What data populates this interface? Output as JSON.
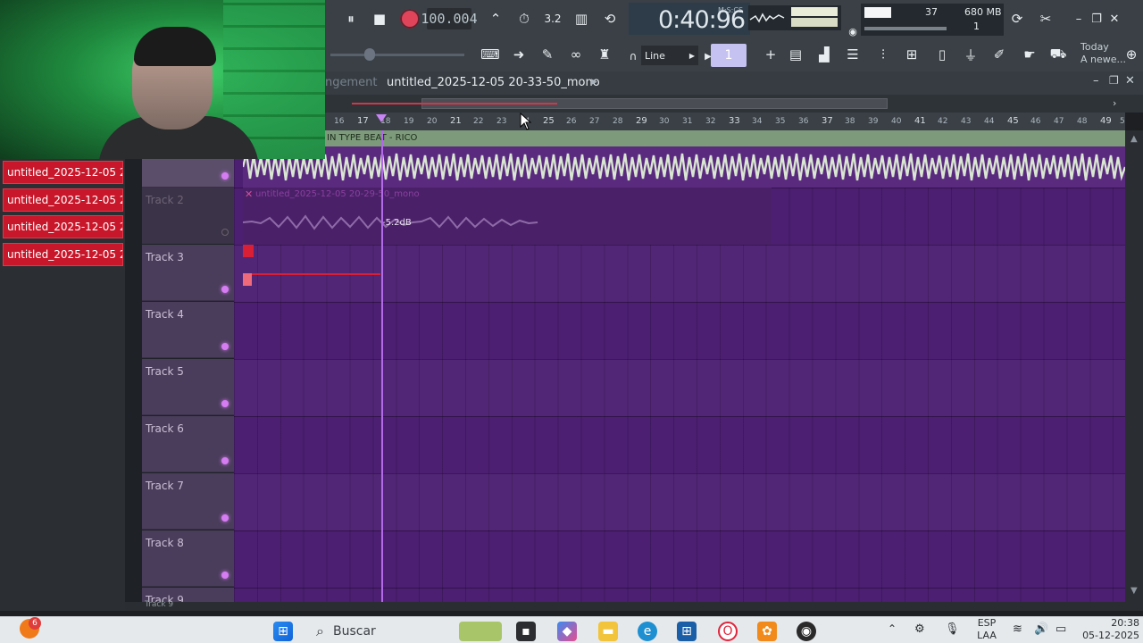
{
  "toolbar": {
    "tempo": "100.004",
    "time": "0:40:96",
    "time_label": "M:S:CS",
    "cpu_value": "37",
    "memory": "680 MB",
    "voices": "1",
    "snap": "Line",
    "pattern_number": "1",
    "hint_title": "Today",
    "hint_text": "A newe..."
  },
  "playlist": {
    "crumb": "ngement",
    "title": "untitled_2025-12-05 20-33-50_mono",
    "ruler_numbers": [
      "16",
      "17",
      "18",
      "19",
      "20",
      "21",
      "22",
      "23",
      "24",
      "25",
      "26",
      "27",
      "28",
      "29",
      "30",
      "31",
      "32",
      "33",
      "34",
      "35",
      "36",
      "37",
      "38",
      "39",
      "40",
      "41",
      "42",
      "43",
      "44",
      "45",
      "46",
      "47",
      "48",
      "49",
      "5"
    ],
    "track1_clip_label": "IN TYPE BEAT - RICO",
    "clip2_label": "untitled_2025-12-05 20-29-50_mono",
    "clip2_gain": "-5.2dB",
    "bottom_label": "Track 9"
  },
  "browser": {
    "items": [
      "untitled_2025-12-05 20...",
      "untitled_2025-12-05 20...",
      "untitled_2025-12-05 20...",
      "untitled_2025-12-05 20..."
    ]
  },
  "tracks": [
    {
      "name": "Track 2"
    },
    {
      "name": "Track 3"
    },
    {
      "name": "Track 4"
    },
    {
      "name": "Track 5"
    },
    {
      "name": "Track 6"
    },
    {
      "name": "Track 7"
    },
    {
      "name": "Track 8"
    },
    {
      "name": "Track 9"
    }
  ],
  "taskbar": {
    "search_placeholder": "Buscar",
    "badge_count": "6",
    "lang_line1": "ESP",
    "lang_line2": "LAA",
    "time": "20:38",
    "date": "05-12-2025"
  },
  "colors": {
    "grid_bg": "#4c1f72",
    "clip_red": "#c8172a",
    "track_header": "#4a3d5b",
    "playhead": "#b36ae8",
    "record": "#e0445a"
  }
}
